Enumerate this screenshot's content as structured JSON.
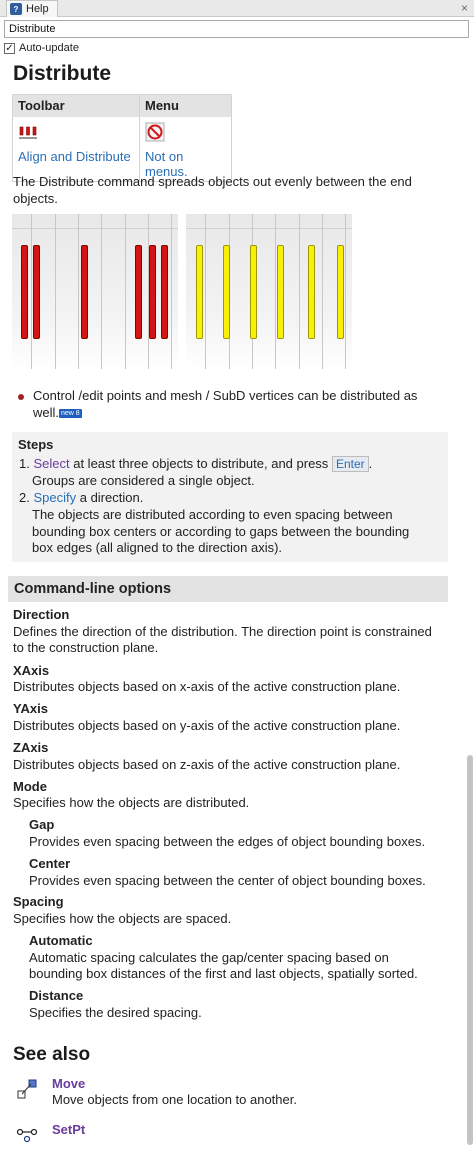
{
  "window": {
    "tab_label": "Help",
    "tab_icon": "help-icon",
    "close_glyph": "×"
  },
  "command_box": {
    "value": "Distribute"
  },
  "auto_update": {
    "label": "Auto-update",
    "checked": true
  },
  "page": {
    "title": "Distribute",
    "toolbar_table": {
      "headers": [
        "Toolbar",
        "Menu"
      ],
      "toolbar_link": "Align and Distribute",
      "menu_link": "Not on menus.",
      "toolbar_icon": "distribute-toolbar-icon",
      "menu_icon": "not-on-menus-icon"
    },
    "intro_line1": "The Distribute command spreads objects out evenly between the end",
    "intro_line2": "objects.",
    "bullet_line1": "Control /edit points and mesh / SubD vertices can be distributed as",
    "bullet_line2": "well.",
    "new_badge": "new 8",
    "steps": {
      "title": "Steps",
      "s1_num": "1.",
      "s1_link": "Select",
      "s1_text": " at least three objects to distribute, and press",
      "s1_key": "Enter",
      "s1_end": ".",
      "s1_line2": "Groups are considered a single object.",
      "s2_num": "2.",
      "s2_link": "Specify",
      "s2_text": " a direction.",
      "s2_line2": "The objects are distributed according to even spacing between",
      "s2_line3": "bounding box centers or according to gaps between the bounding",
      "s2_line4": "box edges (all aligned to the direction axis)."
    },
    "options_header": "Command-line options",
    "options": {
      "direction_name": "Direction",
      "direction_desc1": "Defines the direction of the distribution. The direction point is constrained",
      "direction_desc2": "to the construction plane.",
      "xaxis_name": "XAxis",
      "xaxis_desc": "Distributes objects based on x-axis of the active construction plane.",
      "yaxis_name": "YAxis",
      "yaxis_desc": "Distributes objects based on y-axis of the active construction plane.",
      "zaxis_name": "ZAxis",
      "zaxis_desc": "Distributes objects based on z-axis of the active construction plane.",
      "mode_name": "Mode",
      "mode_desc": "Specifies how the objects are distributed.",
      "gap_name": "Gap",
      "gap_desc": "Provides even spacing between the edges of object bounding boxes.",
      "center_name": "Center",
      "center_desc": "Provides even spacing between the center of object bounding boxes.",
      "spacing_name": "Spacing",
      "spacing_desc": "Specifies how the objects are spaced.",
      "automatic_name": "Automatic",
      "automatic_desc1": "Automatic spacing calculates the gap/center spacing based on",
      "automatic_desc2": "bounding box distances of the first and last objects, spatially sorted.",
      "distance_name": "Distance",
      "distance_desc": "Specifies the desired spacing."
    },
    "see_also_title": "See also",
    "see_also": {
      "move_name": "Move",
      "move_desc": "Move objects from one location to another.",
      "move_icon": "move-icon",
      "setpt_name": "SetPt",
      "setpt_icon": "setpt-icon"
    }
  },
  "colors": {
    "link": "#2a6fb5",
    "visited_link": "#6a3d9a",
    "red_bar": "#d81313",
    "yellow_bar": "#f6f00a",
    "section_bg": "#f2f2f2"
  }
}
